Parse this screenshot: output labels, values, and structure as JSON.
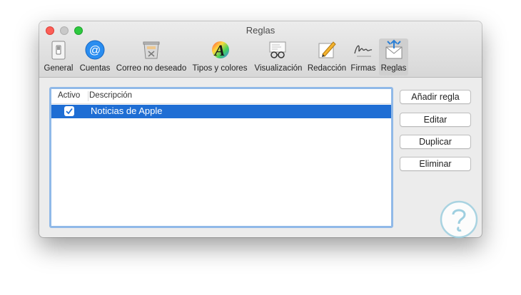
{
  "window": {
    "title": "Reglas"
  },
  "toolbar": {
    "tabs": [
      {
        "label": "General",
        "icon": "general-switch-icon"
      },
      {
        "label": "Cuentas",
        "icon": "at-sign-icon"
      },
      {
        "label": "Correo no deseado",
        "icon": "junk-bin-icon"
      },
      {
        "label": "Tipos y colores",
        "icon": "font-color-icon"
      },
      {
        "label": "Visualización",
        "icon": "glasses-icon"
      },
      {
        "label": "Redacción",
        "icon": "pencil-paper-icon"
      },
      {
        "label": "Firmas",
        "icon": "signature-icon"
      },
      {
        "label": "Reglas",
        "icon": "rules-envelope-icon",
        "selected": true
      }
    ]
  },
  "rules_table": {
    "columns": [
      "Activo",
      "Descripción"
    ],
    "rows": [
      {
        "active": true,
        "description": "Noticias de Apple",
        "selected": true
      }
    ]
  },
  "buttons": {
    "add": "Añadir regla",
    "edit": "Editar",
    "duplicate": "Duplicar",
    "delete": "Eliminar"
  },
  "colors": {
    "selection": "#1f6ed4",
    "focus_ring": "#90b9e8",
    "watermark": "#9ecfe0"
  }
}
